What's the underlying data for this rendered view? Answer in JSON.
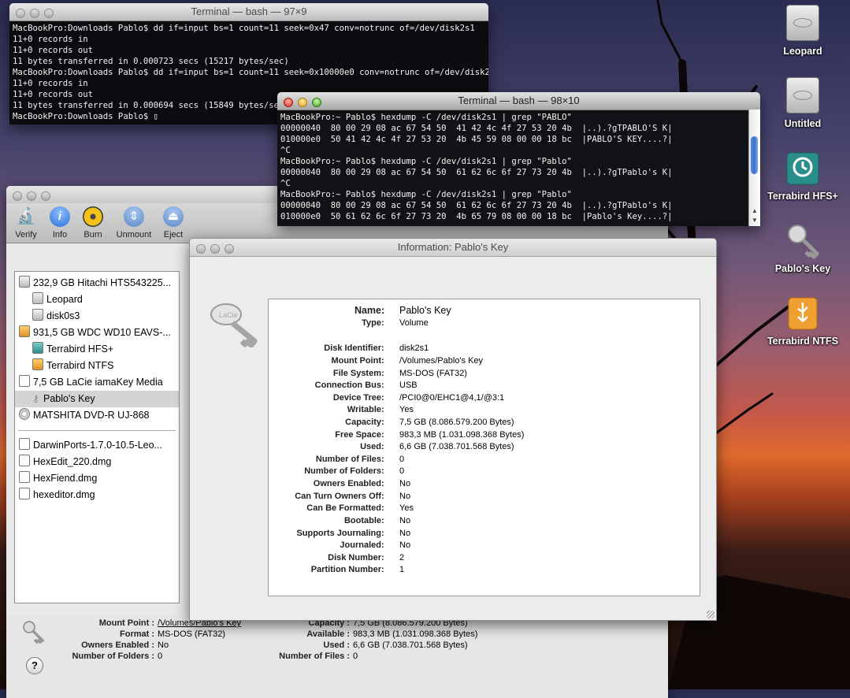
{
  "terminal1": {
    "title": "Terminal — bash — 97×9",
    "lines": [
      "MacBookPro:Downloads Pablo$ dd if=input bs=1 count=11 seek=0x47 conv=notrunc of=/dev/disk2s1",
      "11+0 records in",
      "11+0 records out",
      "11 bytes transferred in 0.000723 secs (15217 bytes/sec)",
      "MacBookPro:Downloads Pablo$ dd if=input bs=1 count=11 seek=0x10000e0 conv=notrunc of=/dev/disk2s1",
      "11+0 records in",
      "11+0 records out",
      "11 bytes transferred in 0.000694 secs (15849 bytes/sec)",
      "MacBookPro:Downloads Pablo$ ▯"
    ]
  },
  "terminal2": {
    "title": "Terminal — bash — 98×10",
    "lines": [
      "MacBookPro:~ Pablo$ hexdump -C /dev/disk2s1 | grep \"PABLO\"",
      "00000040  80 00 29 08 ac 67 54 50  41 42 4c 4f 27 53 20 4b  |..).?gTPABLO'S K|",
      "010000e0  50 41 42 4c 4f 27 53 20  4b 45 59 08 00 00 18 bc  |PABLO'S KEY....?|",
      "^C",
      "MacBookPro:~ Pablo$ hexdump -C /dev/disk2s1 | grep \"Pablo\"",
      "00000040  80 00 29 08 ac 67 54 50  61 62 6c 6f 27 73 20 4b  |..).?gTPablo's K|",
      "^C",
      "MacBookPro:~ Pablo$ hexdump -C /dev/disk2s1 | grep \"Pablo\"",
      "00000040  80 00 29 08 ac 67 54 50  61 62 6c 6f 27 73 20 4b  |..).?gTPablo's K|",
      "010000e0  50 61 62 6c 6f 27 73 20  4b 65 79 08 00 00 18 bc  |Pablo's Key....?|"
    ]
  },
  "desktop": {
    "icons": [
      "Leopard",
      "Untitled",
      "Terrabird HFS+",
      "Pablo's Key",
      "Terrabird NTFS"
    ]
  },
  "disk_utility": {
    "toolbar": [
      "Verify",
      "Info",
      "Burn",
      "Unmount",
      "Eject"
    ],
    "sidebar": [
      {
        "label": "232,9 GB Hitachi HTS543225...",
        "level": 0
      },
      {
        "label": "Leopard",
        "level": 1
      },
      {
        "label": "disk0s3",
        "level": 1
      },
      {
        "label": "931,5 GB WDC WD10 EAVS-...",
        "level": 0
      },
      {
        "label": "Terrabird HFS+",
        "level": 1
      },
      {
        "label": "Terrabird NTFS",
        "level": 1
      },
      {
        "label": "7,5 GB LaCie iamaKey Media",
        "level": 0
      },
      {
        "label": "Pablo's Key",
        "level": 1
      },
      {
        "label": "MATSHITA DVD-R UJ-868",
        "level": 0
      }
    ],
    "images": [
      "DarwinPorts-1.7.0-10.5-Leo...",
      "HexEdit_220.dmg",
      "HexFiend.dmg",
      "hexeditor.dmg"
    ],
    "footer": {
      "mount_point_k": "Mount Point :",
      "mount_point_v": "/Volumes/Pablo's Key",
      "format_k": "Format :",
      "format_v": "MS-DOS (FAT32)",
      "owners_k": "Owners Enabled :",
      "owners_v": "No",
      "folders_k": "Number of Folders :",
      "folders_v": "0",
      "capacity_k": "Capacity :",
      "capacity_v": "7,5 GB (8.086.579.200 Bytes)",
      "available_k": "Available :",
      "available_v": "983,3 MB (1.031.098.368 Bytes)",
      "used_k": "Used :",
      "used_v": "6,6 GB (7.038.701.568 Bytes)",
      "files_k": "Number of Files :",
      "files_v": "0",
      "help": "?"
    }
  },
  "info": {
    "title": "Information: Pablo's Key",
    "rows": [
      {
        "k": "Name",
        "v": "Pablo's Key"
      },
      {
        "k": "Type",
        "v": "Volume"
      },
      {
        "k": "Disk Identifier",
        "v": "disk2s1"
      },
      {
        "k": "Mount Point",
        "v": "/Volumes/Pablo's Key"
      },
      {
        "k": "File System",
        "v": "MS-DOS (FAT32)"
      },
      {
        "k": "Connection Bus",
        "v": "USB"
      },
      {
        "k": "Device Tree",
        "v": "/PCI0@0/EHC1@4,1/@3:1"
      },
      {
        "k": "Writable",
        "v": "Yes"
      },
      {
        "k": "Capacity",
        "v": "7,5 GB (8.086.579.200 Bytes)"
      },
      {
        "k": "Free Space",
        "v": "983,3 MB (1.031.098.368 Bytes)"
      },
      {
        "k": "Used",
        "v": "6,6 GB (7.038.701.568 Bytes)"
      },
      {
        "k": "Number of Files",
        "v": "0"
      },
      {
        "k": "Number of Folders",
        "v": "0"
      },
      {
        "k": "Owners Enabled",
        "v": "No"
      },
      {
        "k": "Can Turn Owners Off",
        "v": "No"
      },
      {
        "k": "Can Be Formatted",
        "v": "Yes"
      },
      {
        "k": "Bootable",
        "v": "No"
      },
      {
        "k": "Supports Journaling",
        "v": "No"
      },
      {
        "k": "Journaled",
        "v": "No"
      },
      {
        "k": "Disk Number",
        "v": "2"
      },
      {
        "k": "Partition Number",
        "v": "1"
      }
    ],
    "colon": ":"
  }
}
